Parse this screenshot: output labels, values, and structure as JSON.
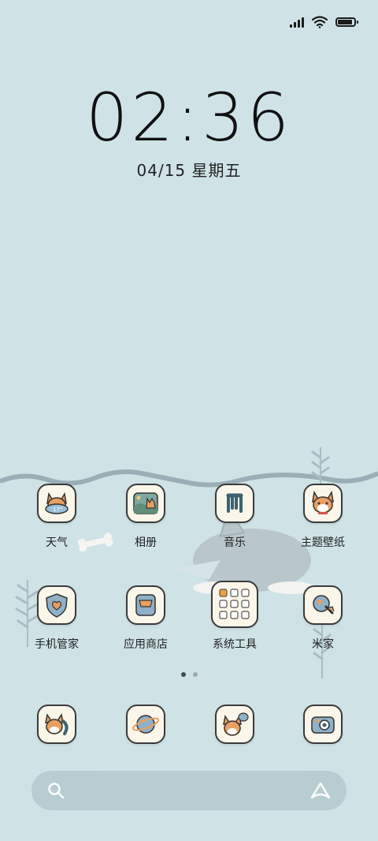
{
  "status": {
    "signal_bars": 4,
    "wifi_icon": "wifi-icon",
    "battery_level": 1.0
  },
  "lockscreen": {
    "time": "02:36",
    "date": "04/15 星期五"
  },
  "apps": [
    {
      "label": "天气",
      "icon": "weather-corgi-icon"
    },
    {
      "label": "相册",
      "icon": "gallery-corgi-icon"
    },
    {
      "label": "音乐",
      "icon": "music-note-icon"
    },
    {
      "label": "主题壁纸",
      "icon": "themes-corgi-icon"
    },
    {
      "label": "手机管家",
      "icon": "security-shield-icon"
    },
    {
      "label": "应用商店",
      "icon": "app-store-icon"
    },
    {
      "label": "系统工具",
      "icon": "tools-folder-icon"
    },
    {
      "label": "米家",
      "icon": "mi-home-icon"
    }
  ],
  "dock": [
    {
      "icon": "phone-corgi-icon"
    },
    {
      "icon": "browser-planet-icon"
    },
    {
      "icon": "messages-corgi-icon"
    },
    {
      "icon": "camera-icon"
    }
  ],
  "pager": {
    "pages": 2,
    "current": 1
  },
  "search": {
    "search_icon": "search-icon",
    "assistant_icon": "assistant-icon"
  },
  "colors": {
    "background": "#cfe3e7",
    "icon_bg": "#fbf6ea",
    "corgi_orange": "#e8a060"
  }
}
